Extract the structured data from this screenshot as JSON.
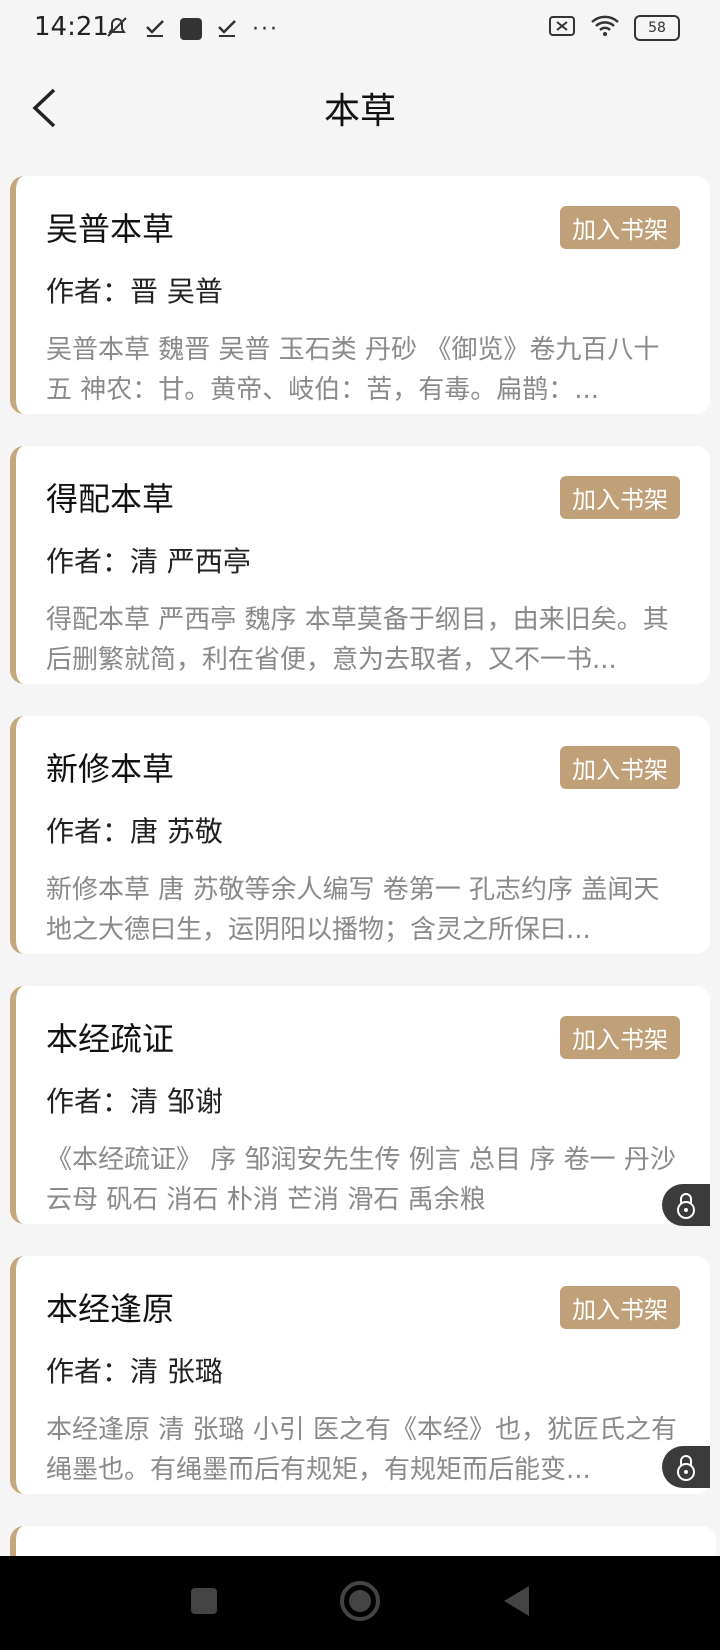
{
  "status": {
    "time": "14:21",
    "battery": "58"
  },
  "header": {
    "title": "本草"
  },
  "books": [
    {
      "title": "吴普本草",
      "author": "作者：晋 吴普",
      "description": "吴普本草 魏晋 吴普 玉石类 丹砂 《御览》卷九百八十五 神农：甘。黄帝、岐伯：苦，有毒。扁鹊：...",
      "add_label": "加入书架"
    },
    {
      "title": "得配本草",
      "author": "作者：清 严西亭",
      "description": "得配本草 严西亭 魏序 本草莫备于纲目，由来旧矣。其后删繁就简，利在省便，意为去取者，又不一书...",
      "add_label": "加入书架"
    },
    {
      "title": "新修本草",
      "author": "作者：唐 苏敬",
      "description": "新修本草 唐 苏敬等余人编写 卷第一 孔志约序 盖闻天地之大德曰生，运阴阳以播物；含灵之所保曰...",
      "add_label": "加入书架"
    },
    {
      "title": "本经疏证",
      "author": "作者：清 邹谢",
      "description": "《本经疏证》 序 邹润安先生传 例言 总目 序 卷一 丹沙 云母 矾石 消石 朴消 芒消 滑石 禹余粮",
      "add_label": "加入书架"
    },
    {
      "title": "本经逢原",
      "author": "作者：清 张璐",
      "description": "本经逢原 清 张璐 小引 医之有《本经》也，犹匠氏之有绳墨也。有绳墨而后有规矩，有规矩而后能变...",
      "add_label": "加入书架"
    }
  ],
  "colors": {
    "accent": "#c6a77d",
    "button": "#bfa078"
  }
}
